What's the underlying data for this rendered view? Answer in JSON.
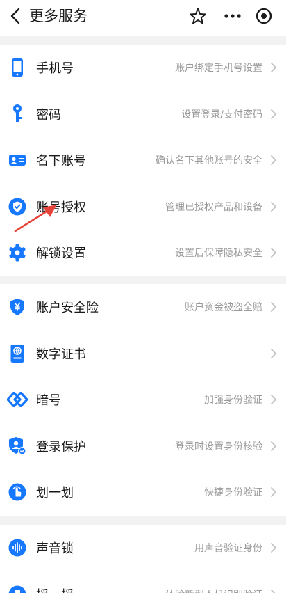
{
  "header": {
    "title": "更多服务",
    "icons": [
      "back-icon",
      "star-icon",
      "more-icon",
      "target-icon"
    ]
  },
  "groups": [
    {
      "items": [
        {
          "label": "手机号",
          "desc": "账户绑定手机号设置",
          "icon": "phone-icon"
        },
        {
          "label": "密码",
          "desc": "设置登录/支付密码",
          "icon": "key-icon"
        },
        {
          "label": "名下账号",
          "desc": "确认名下其他账号的安全",
          "icon": "id-card-icon"
        },
        {
          "label": "账号授权",
          "desc": "管理已授权产品和设备",
          "icon": "shield-check-icon"
        },
        {
          "label": "解锁设置",
          "desc": "设置后保障隐私安全",
          "icon": "gear-icon"
        }
      ]
    },
    {
      "items": [
        {
          "label": "账户安全险",
          "desc": "账户资金被盗全赔",
          "icon": "insurance-icon"
        },
        {
          "label": "数字证书",
          "desc": "",
          "icon": "certificate-icon"
        },
        {
          "label": "暗号",
          "desc": "加强身份验证",
          "icon": "diamond-link-icon"
        },
        {
          "label": "登录保护",
          "desc": "登录时设置身份核验",
          "icon": "user-shield-icon"
        },
        {
          "label": "划一划",
          "desc": "快捷身份验证",
          "icon": "swipe-hand-icon"
        }
      ]
    },
    {
      "items": [
        {
          "label": "声音锁",
          "desc": "用声音验证身份",
          "icon": "voice-icon"
        },
        {
          "label": "摇一摇",
          "desc": "体验新型人机识别验证",
          "icon": "shake-icon"
        }
      ]
    }
  ],
  "colors": {
    "accent": "#1677ff",
    "text": "#1a1a1a",
    "subtext": "#9a9a9a",
    "separator": "#f2f2f2",
    "annotation_arrow": "#e8433b"
  }
}
